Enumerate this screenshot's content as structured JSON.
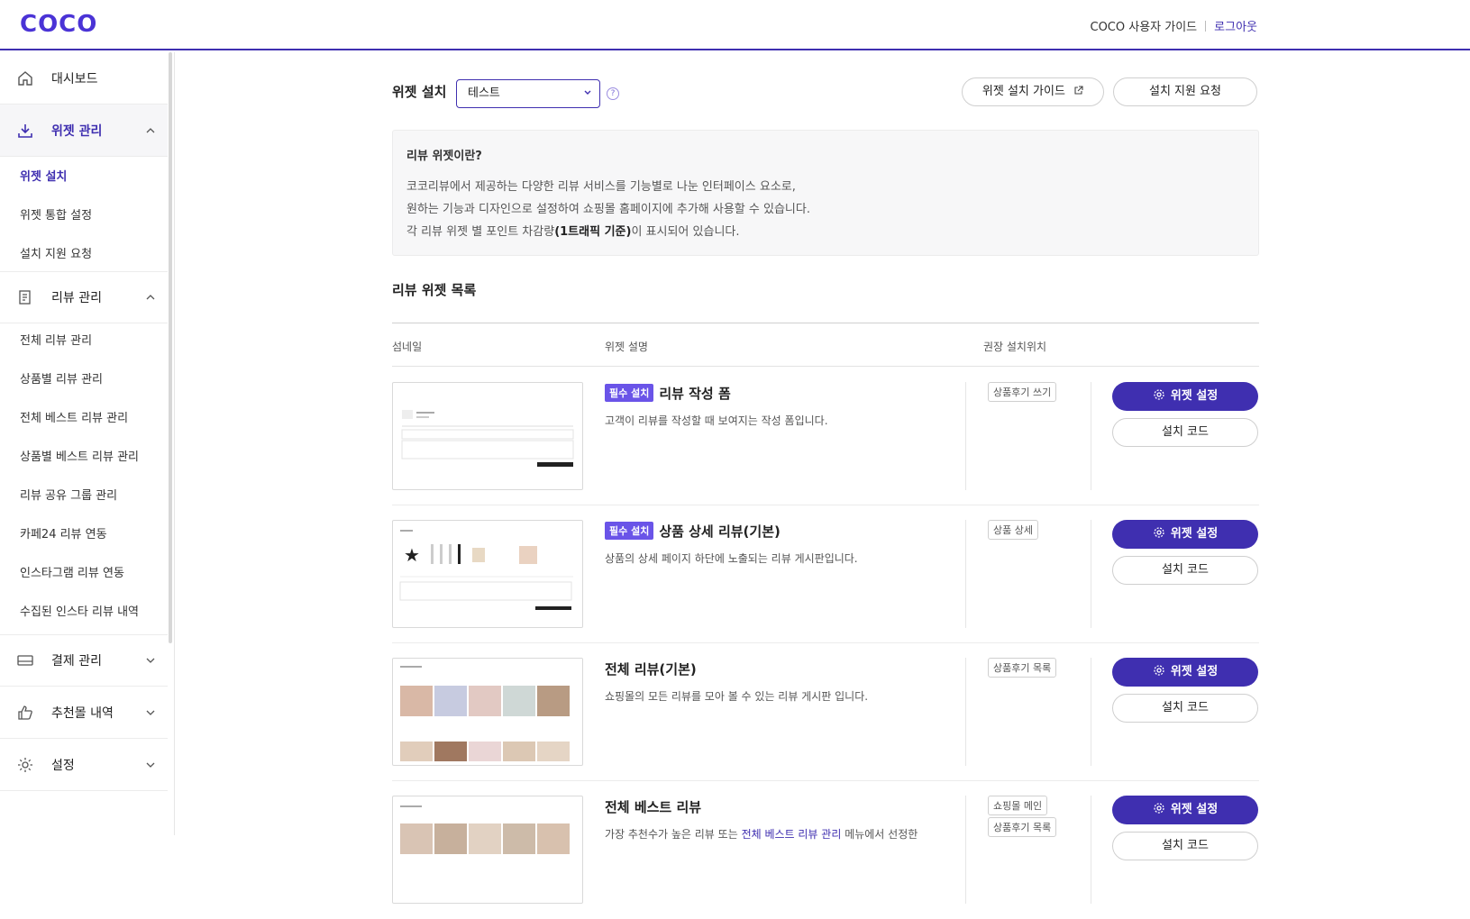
{
  "brand": {
    "logo": "COCO",
    "accent": "#3f2fb0",
    "badge_color": "#6a54e8"
  },
  "header": {
    "guide_link": "COCO 사용자 가이드",
    "logout": "로그아웃"
  },
  "sidebar": {
    "dashboard": "대시보드",
    "widget_mgmt": "위젯 관리",
    "widget_sub": [
      "위젯 설치",
      "위젯 통합 설정",
      "설치 지원 요청"
    ],
    "review_mgmt": "리뷰 관리",
    "review_sub": [
      "전체 리뷰 관리",
      "상품별 리뷰 관리",
      "전체 베스트 리뷰 관리",
      "상품별 베스트 리뷰 관리",
      "리뷰 공유 그룹 관리",
      "카페24 리뷰 연동",
      "인스타그램 리뷰 연동",
      "수집된 인스타 리뷰 내역"
    ],
    "payment": "결제 관리",
    "recommend": "추천몰 내역",
    "settings": "설정"
  },
  "install": {
    "label": "위젯 설치",
    "select_value": "테스트",
    "help": "?",
    "guide_button": "위젯 설치 가이드",
    "support_button": "설치 지원 요청"
  },
  "info": {
    "title": "리뷰 위젯이란?",
    "line1": "코코리뷰에서 제공하는 다양한 리뷰 서비스를 기능별로 나눈 인터페이스 요소로,",
    "line2": "원하는 기능과 디자인으로 설정하여 쇼핑몰 홈페이지에 추가해 사용할 수 있습니다.",
    "line3_pre": "각 리뷰 위젯 별 포인트 차감량",
    "line3_bold": "(1트래픽 기준)",
    "line3_post": "이 표시되어 있습니다."
  },
  "list": {
    "title": "리뷰 위젯 목록",
    "col_thumb": "섬네일",
    "col_desc": "위젯 설명",
    "col_location": "권장 설치위치",
    "required_badge": "필수 설치",
    "settings_button": "위젯 설정",
    "code_button": "설치 코드",
    "rows": [
      {
        "title": "리뷰 작성 폼",
        "desc": "고객이 리뷰를 작성할 때 보여지는 작성 폼입니다.",
        "tag1": "상품후기 쓰기"
      },
      {
        "title": "상품 상세 리뷰(기본)",
        "desc": "상품의 상세 페이지 하단에 노출되는 리뷰 게시판입니다.",
        "tag1": "상품 상세"
      },
      {
        "title": "전체 리뷰(기본)",
        "desc": "쇼핑몰의 모든 리뷰를 모아 볼 수 있는 리뷰 게시판 입니다.",
        "tag1": "상품후기 목록"
      },
      {
        "title": "전체 베스트 리뷰",
        "desc_pre": "가장 추천수가 높은 리뷰 또는 ",
        "desc_link": "전체 베스트 리뷰 관리",
        "desc_post": " 메뉴에서 선정한",
        "tag1": "쇼핑몰 메인",
        "tag2": "상품후기 목록"
      }
    ]
  }
}
